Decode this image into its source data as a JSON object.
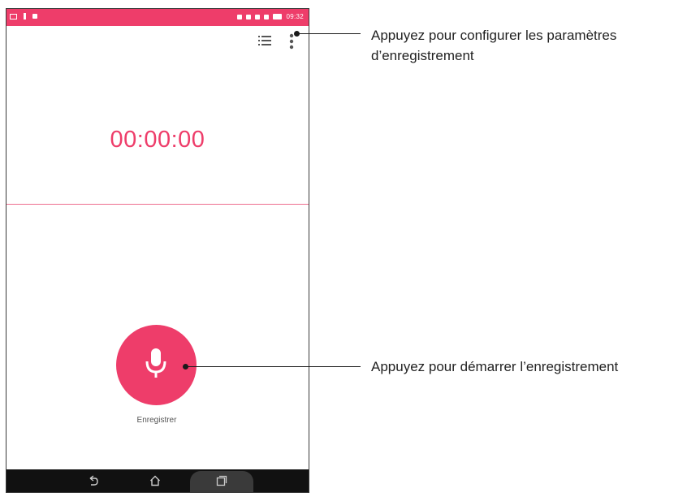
{
  "status_bar": {
    "time": "09:32",
    "color": "#ee3d6a"
  },
  "toolbar": {
    "list_icon": "list-icon",
    "more_icon": "more-vert-icon"
  },
  "timer": {
    "value": "00:00:00",
    "color": "#ee3d6a"
  },
  "record": {
    "label": "Enregistrer",
    "icon": "microphone-icon",
    "color": "#ee3d6a"
  },
  "nav": {
    "back_icon": "back-icon",
    "home_icon": "home-icon",
    "recents_icon": "recent-apps-icon"
  },
  "annotations": {
    "settings_line1": "Appuyez pour configurer les paramètres",
    "settings_line2": "d’enregistrement",
    "record": "Appuyez pour démarrer l’enregistrement"
  }
}
